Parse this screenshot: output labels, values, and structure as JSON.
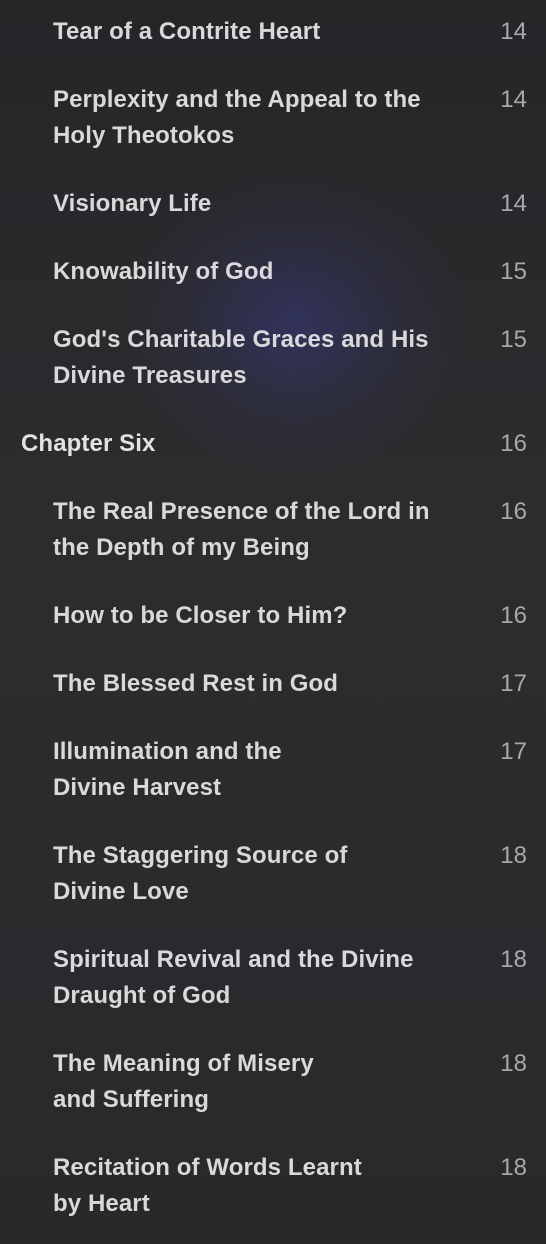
{
  "toc": {
    "items": [
      {
        "title": "Tear of a Contrite Heart",
        "page": "14",
        "level": "section"
      },
      {
        "title": "Perplexity and the Appeal to the\nHoly Theotokos",
        "page": "14",
        "level": "section"
      },
      {
        "title": "Visionary Life",
        "page": "14",
        "level": "section"
      },
      {
        "title": "Knowability of God",
        "page": "15",
        "level": "section"
      },
      {
        "title": "God's Charitable Graces and His\nDivine Treasures",
        "page": "15",
        "level": "section"
      },
      {
        "title": "Chapter Six",
        "page": "16",
        "level": "chapter"
      },
      {
        "title": "The Real Presence of the Lord in\nthe Depth of my Being",
        "page": "16",
        "level": "section"
      },
      {
        "title": "How to be Closer to Him?",
        "page": "16",
        "level": "section"
      },
      {
        "title": "The Blessed Rest in God",
        "page": "17",
        "level": "section"
      },
      {
        "title": "Illumination and the\nDivine Harvest",
        "page": "17",
        "level": "section"
      },
      {
        "title": "The Staggering Source of\nDivine Love",
        "page": "18",
        "level": "section"
      },
      {
        "title": "Spiritual Revival and the Divine\nDraught of God",
        "page": "18",
        "level": "section"
      },
      {
        "title": "The Meaning of Misery\nand Suffering",
        "page": "18",
        "level": "section"
      },
      {
        "title": "Recitation of Words Learnt\nby Heart",
        "page": "18",
        "level": "section"
      }
    ]
  }
}
